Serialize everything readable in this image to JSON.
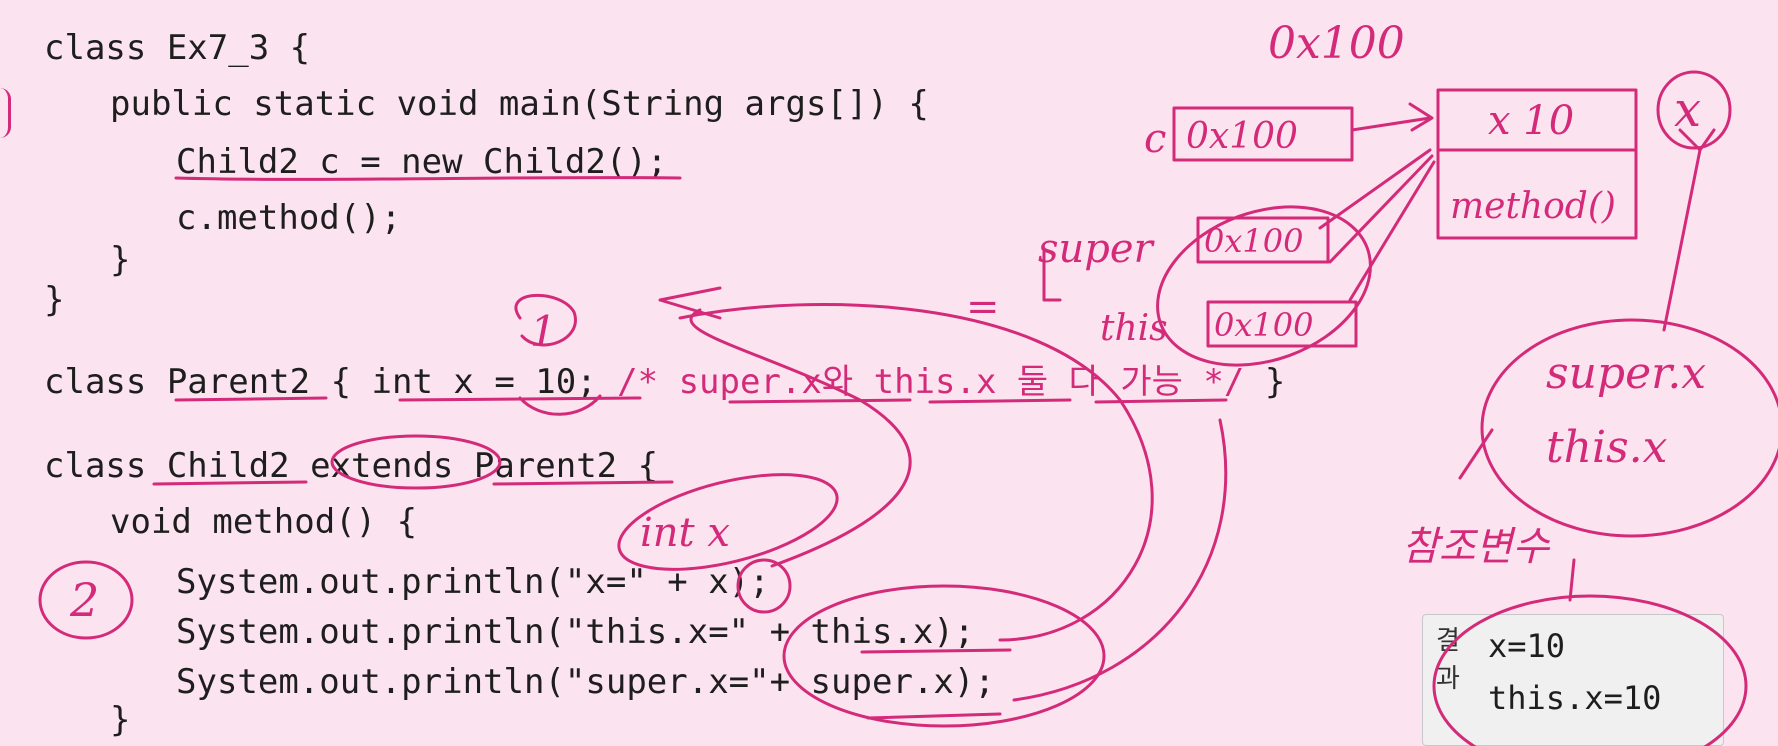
{
  "code": {
    "lines": [
      "class Ex7_3 {",
      "public static void main(String args[]) {",
      "Child2 c = new Child2();",
      "c.method();",
      "}",
      "}",
      "class Parent2 { int x = 10; ",
      "/* super.x와 this.x 둘 다 가능 */",
      " }",
      "class Child2 extends Parent2 {",
      "void method() {",
      "System.out.println(\"x=\" + x);",
      "System.out.println(\"this.x=\" + this.x);",
      "System.out.println(\"super.x=\"+ super.x);",
      "}"
    ]
  },
  "result": {
    "label_line1": "결",
    "label_line2": "과",
    "output": [
      "x=10",
      "this.x=10"
    ]
  },
  "annotations": {
    "circle_1": "1",
    "circle_2": "2",
    "int_x": "int x",
    "addr_top": "0x100",
    "c_label": "c",
    "c_addr": "0x100",
    "super_label": "super",
    "super_addr": "0x100",
    "this_label": "this",
    "this_addr": "0x100",
    "obj_field": "x 10",
    "obj_method": "method()",
    "circled_x": "x",
    "note_super_x": "super.x",
    "note_this_x": "this.x",
    "note_ref": "참조변수",
    "equals_mark": "="
  },
  "colors": {
    "background": "#fbe4ef",
    "ink": "#d42a7a",
    "code": "#1e1e1e"
  }
}
